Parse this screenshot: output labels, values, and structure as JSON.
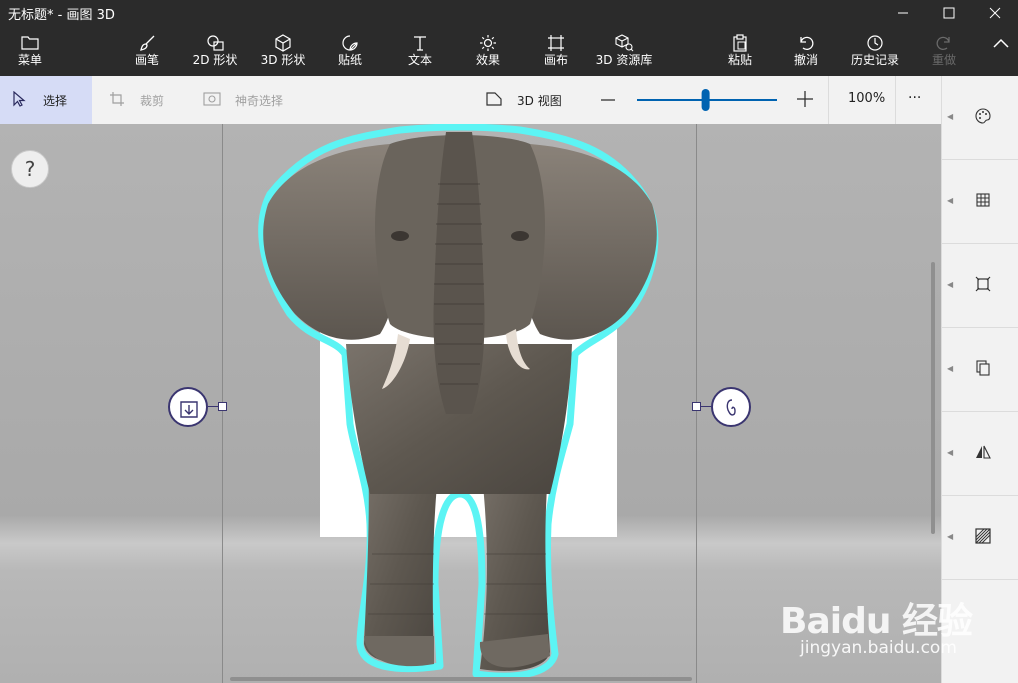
{
  "window": {
    "title": "无标题* - 画图 3D"
  },
  "ribbon": {
    "menu": "菜单",
    "brushes": "画笔",
    "shapes_2d": "2D 形状",
    "shapes_3d": "3D 形状",
    "stickers": "贴纸",
    "text": "文本",
    "effects": "效果",
    "canvas": "画布",
    "library_3d": "3D 资源库",
    "paste": "粘贴",
    "undo": "撤消",
    "history": "历史记录",
    "redo": "重做"
  },
  "toolbar": {
    "select": "选择",
    "crop": "裁剪",
    "magic_select": "神奇选择",
    "view_3d": "3D 视图",
    "zoom_level": "100%",
    "zoom_fraction": 0.49,
    "more": "···"
  },
  "canvas": {
    "help": "?"
  },
  "sidepanel": {
    "items": [
      "palette-icon",
      "grid-icon",
      "crop-frame-icon",
      "copy-icon",
      "flip-icon",
      "texture-icon"
    ]
  },
  "watermark": {
    "brand": "Baidu 经验",
    "url": "jingyan.baidu.com"
  },
  "colors": {
    "accent": "#0063b1",
    "selection": "#5cf4f4",
    "handle": "#3a3570"
  }
}
